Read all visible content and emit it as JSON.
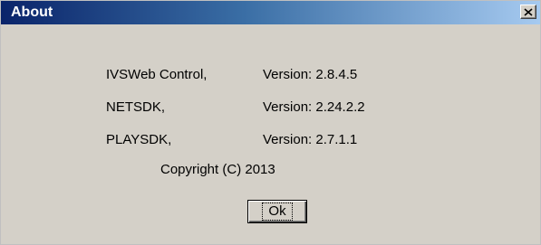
{
  "window": {
    "title": "About",
    "close_label": "close"
  },
  "info_rows": [
    {
      "name": "IVSWeb Control,",
      "version": "Version: 2.8.4.5"
    },
    {
      "name": "NETSDK,",
      "version": "Version: 2.24.2.2"
    },
    {
      "name": "PLAYSDK,",
      "version": "Version: 2.7.1.1"
    }
  ],
  "copyright": "Copyright (C) 2013",
  "buttons": {
    "ok_label": "Ok"
  },
  "colors": {
    "titlebar_start": "#0a246a",
    "titlebar_end": "#a6caf0",
    "dialog_background": "#d4d0c8"
  }
}
